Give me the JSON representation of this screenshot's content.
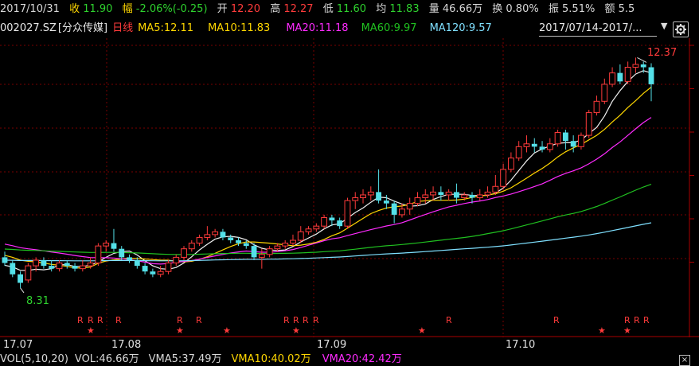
{
  "info": {
    "date": "2017/10/31",
    "close_label": "收",
    "close": "11.90",
    "change_label": "幅",
    "change": "-2.06%(-0.25)",
    "open_label": "开",
    "open": "12.20",
    "high_label": "高",
    "high": "12.27",
    "low_label": "低",
    "low": "11.60",
    "avg_label": "均",
    "avg": "11.83",
    "vol_label": "量",
    "vol": "46.66万",
    "turnover_label": "换",
    "turnover": "0.80%",
    "amp_label": "振",
    "amp": "5.51%",
    "amount_label": "额",
    "amount": "5.5"
  },
  "ma": {
    "code": "002027.SZ",
    "name": "[分众传媒]",
    "period": "日线",
    "ma5": "MA5:12.11",
    "ma10": "MA10:11.83",
    "ma20": "MA20:11.18",
    "ma60": "MA60:9.97",
    "ma120": "MA120:9.57",
    "daterange": "2017/07/14-2017/...",
    "dropdown": "▼"
  },
  "colors": {
    "up": "#ff3b3b",
    "down": "#54e0e8",
    "ma5": "#f0f0f0",
    "ma10": "#ffd700",
    "ma20": "#ff2bff",
    "ma60": "#20c020",
    "ma120": "#7fe0ff",
    "grid": "#7a0000"
  },
  "chart": {
    "max_label": "12.37",
    "min_label": "8.31",
    "r_mark": "R",
    "star_mark": "★",
    "ticks": [
      "17.07",
      "17.08",
      "17.09",
      "17.10"
    ]
  },
  "vol": {
    "title": "VOL(5,10,20)",
    "vol": "VOL:46.66万",
    "vma5": "VMA5:37.49万",
    "vma10": "VMA10:40.02万",
    "vma20": "VMA20:42.42万"
  },
  "chart_data": {
    "type": "candlestick",
    "date_range": "2017/07/14-2017/10/31",
    "categories_ticks": [
      "17.07",
      "17.08",
      "17.09",
      "17.10"
    ],
    "ylim": [
      8.0,
      12.6
    ],
    "candles": [
      [
        8.85,
        8.75,
        8.95,
        8.7
      ],
      [
        8.75,
        8.55,
        8.8,
        8.5
      ],
      [
        8.55,
        8.4,
        8.6,
        8.31
      ],
      [
        8.45,
        8.7,
        8.75,
        8.4
      ],
      [
        8.7,
        8.8,
        8.85,
        8.6
      ],
      [
        8.8,
        8.7,
        8.85,
        8.65
      ],
      [
        8.7,
        8.65,
        8.8,
        8.6
      ],
      [
        8.65,
        8.75,
        8.8,
        8.6
      ],
      [
        8.75,
        8.7,
        8.8,
        8.65
      ],
      [
        8.7,
        8.65,
        8.75,
        8.6
      ],
      [
        8.65,
        8.7,
        8.8,
        8.6
      ],
      [
        8.7,
        8.75,
        8.85,
        8.65
      ],
      [
        8.75,
        9.05,
        9.1,
        8.7
      ],
      [
        9.05,
        9.1,
        9.15,
        8.95
      ],
      [
        9.1,
        9.0,
        9.35,
        8.95
      ],
      [
        9.0,
        8.85,
        9.05,
        8.8
      ],
      [
        8.85,
        8.8,
        8.9,
        8.75
      ],
      [
        8.8,
        8.7,
        8.85,
        8.65
      ],
      [
        8.7,
        8.6,
        8.75,
        8.55
      ],
      [
        8.6,
        8.55,
        8.65,
        8.5
      ],
      [
        8.55,
        8.6,
        8.7,
        8.5
      ],
      [
        8.6,
        8.75,
        8.8,
        8.55
      ],
      [
        8.75,
        8.85,
        8.9,
        8.7
      ],
      [
        8.85,
        9.0,
        9.05,
        8.8
      ],
      [
        9.0,
        9.1,
        9.15,
        8.95
      ],
      [
        9.1,
        9.2,
        9.25,
        9.05
      ],
      [
        9.2,
        9.25,
        9.4,
        9.15
      ],
      [
        9.25,
        9.3,
        9.35,
        9.2
      ],
      [
        9.3,
        9.2,
        9.35,
        9.15
      ],
      [
        9.2,
        9.15,
        9.25,
        9.1
      ],
      [
        9.15,
        9.1,
        9.2,
        9.05
      ],
      [
        9.1,
        9.05,
        9.15,
        9.0
      ],
      [
        9.05,
        8.85,
        9.1,
        8.8
      ],
      [
        8.85,
        8.9,
        9.0,
        8.65
      ],
      [
        8.9,
        9.0,
        9.05,
        8.85
      ],
      [
        9.0,
        9.05,
        9.1,
        8.95
      ],
      [
        9.05,
        9.1,
        9.15,
        9.0
      ],
      [
        9.1,
        9.15,
        9.25,
        9.05
      ],
      [
        9.15,
        9.3,
        9.4,
        9.1
      ],
      [
        9.3,
        9.35,
        9.4,
        9.25
      ],
      [
        9.35,
        9.4,
        9.45,
        9.3
      ],
      [
        9.4,
        9.55,
        9.6,
        9.35
      ],
      [
        9.55,
        9.5,
        9.6,
        9.4
      ],
      [
        9.5,
        9.4,
        9.55,
        9.35
      ],
      [
        9.4,
        9.85,
        9.9,
        9.35
      ],
      [
        9.85,
        9.9,
        10.0,
        9.7
      ],
      [
        9.9,
        9.95,
        10.05,
        9.8
      ],
      [
        9.95,
        10.0,
        10.1,
        9.85
      ],
      [
        10.0,
        9.85,
        10.4,
        9.8
      ],
      [
        9.85,
        9.8,
        9.95,
        9.7
      ],
      [
        9.8,
        9.6,
        9.85,
        9.45
      ],
      [
        9.6,
        9.7,
        9.8,
        9.55
      ],
      [
        9.7,
        9.8,
        9.9,
        9.6
      ],
      [
        9.8,
        9.9,
        10.0,
        9.75
      ],
      [
        9.9,
        9.95,
        10.05,
        9.8
      ],
      [
        9.95,
        10.0,
        10.1,
        9.85
      ],
      [
        10.0,
        9.95,
        10.1,
        9.85
      ],
      [
        9.95,
        10.0,
        10.05,
        9.85
      ],
      [
        10.0,
        9.9,
        10.15,
        9.8
      ],
      [
        9.9,
        9.95,
        10.0,
        9.85
      ],
      [
        9.95,
        9.9,
        10.0,
        9.8
      ],
      [
        9.9,
        9.95,
        10.05,
        9.85
      ],
      [
        9.95,
        10.0,
        10.1,
        9.9
      ],
      [
        10.0,
        10.1,
        10.3,
        9.95
      ],
      [
        10.1,
        10.4,
        10.5,
        10.05
      ],
      [
        10.4,
        10.6,
        10.7,
        10.35
      ],
      [
        10.6,
        10.8,
        10.9,
        10.55
      ],
      [
        10.8,
        10.85,
        11.0,
        10.7
      ],
      [
        10.85,
        10.8,
        10.95,
        10.7
      ],
      [
        10.8,
        10.75,
        10.9,
        10.7
      ],
      [
        10.75,
        10.85,
        10.95,
        10.7
      ],
      [
        10.85,
        11.05,
        11.1,
        10.8
      ],
      [
        11.05,
        10.9,
        11.1,
        10.75
      ],
      [
        10.9,
        10.8,
        11.0,
        10.7
      ],
      [
        10.8,
        11.0,
        11.05,
        10.75
      ],
      [
        11.0,
        11.4,
        11.45,
        10.95
      ],
      [
        11.4,
        11.6,
        11.7,
        11.35
      ],
      [
        11.6,
        11.9,
        12.0,
        11.55
      ],
      [
        11.9,
        12.1,
        12.2,
        11.85
      ],
      [
        12.1,
        11.95,
        12.25,
        11.9
      ],
      [
        11.95,
        12.2,
        12.3,
        11.9
      ],
      [
        12.2,
        12.25,
        12.37,
        12.1
      ],
      [
        12.25,
        12.2,
        12.3,
        12.1
      ],
      [
        12.2,
        11.9,
        12.27,
        11.6
      ]
    ]
  }
}
